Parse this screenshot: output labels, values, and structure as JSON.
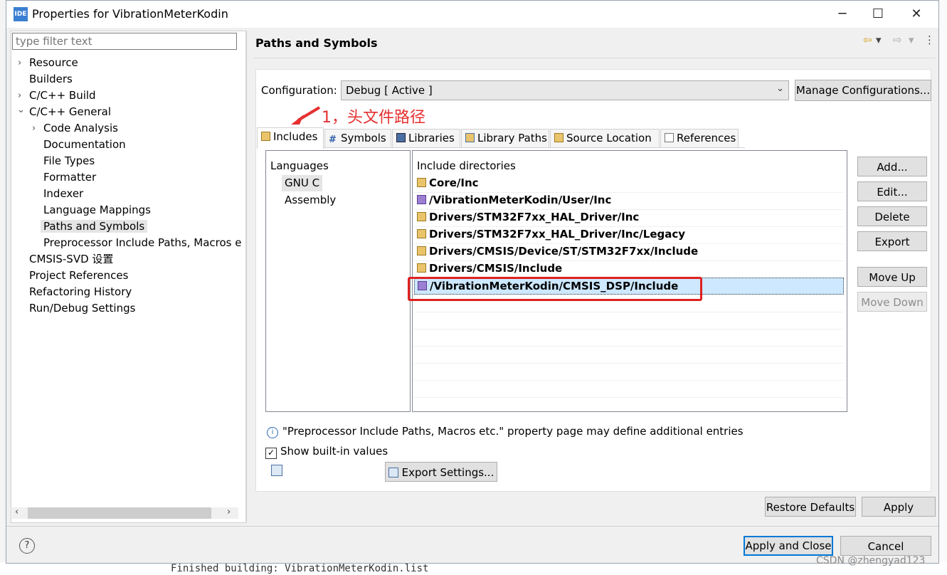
{
  "window": {
    "title": "Properties for VibrationMeterKodin",
    "icon_label": "IDE",
    "controls": [
      "─",
      "☐",
      "✕"
    ]
  },
  "filter": {
    "placeholder": "type filter text"
  },
  "tree": [
    {
      "label": "Resource",
      "twisty": "›"
    },
    {
      "label": "Builders",
      "twisty": ""
    },
    {
      "label": "C/C++ Build",
      "twisty": "›"
    },
    {
      "label": "C/C++ General",
      "twisty": "⌄"
    },
    {
      "label": "Code Analysis",
      "twisty": "›"
    },
    {
      "label": "Documentation",
      "twisty": ""
    },
    {
      "label": "File Types",
      "twisty": ""
    },
    {
      "label": "Formatter",
      "twisty": ""
    },
    {
      "label": "Indexer",
      "twisty": ""
    },
    {
      "label": "Language Mappings",
      "twisty": ""
    },
    {
      "label": "Paths and Symbols",
      "twisty": ""
    },
    {
      "label": "Preprocessor Include Paths, Macros e",
      "twisty": ""
    },
    {
      "label": "CMSIS-SVD 设置",
      "twisty": ""
    },
    {
      "label": "Project References",
      "twisty": ""
    },
    {
      "label": "Refactoring History",
      "twisty": ""
    },
    {
      "label": "Run/Debug Settings",
      "twisty": ""
    }
  ],
  "page": {
    "title": "Paths and Symbols",
    "nav": {
      "back": "⇦",
      "dropdown": "▾",
      "forward": "⇨",
      "more": "⋮"
    }
  },
  "configuration": {
    "label": "Configuration:",
    "value": "Debug  [ Active ]",
    "manage_button": "Manage Configurations..."
  },
  "annotation": {
    "text": "1，头文件路径",
    "color": "#e53030"
  },
  "tabs": [
    "Includes",
    "Symbols",
    "Libraries",
    "Library Paths",
    "Source Location",
    "References"
  ],
  "languages": {
    "header": "Languages",
    "items": [
      "GNU C",
      "Assembly"
    ],
    "selected": "GNU C"
  },
  "includes": {
    "header": "Include directories",
    "items": [
      {
        "path": "Core/Inc",
        "type": "folder"
      },
      {
        "path": "/VibrationMeterKodin/User/Inc",
        "type": "workspace"
      },
      {
        "path": "Drivers/STM32F7xx_HAL_Driver/Inc",
        "type": "folder"
      },
      {
        "path": "Drivers/STM32F7xx_HAL_Driver/Inc/Legacy",
        "type": "folder"
      },
      {
        "path": "Drivers/CMSIS/Device/ST/STM32F7xx/Include",
        "type": "folder"
      },
      {
        "path": "Drivers/CMSIS/Include",
        "type": "folder"
      },
      {
        "path": "/VibrationMeterKodin/CMSIS_DSP/Include",
        "type": "workspace",
        "selected": true
      }
    ]
  },
  "side_buttons": {
    "add": "Add...",
    "edit": "Edit...",
    "delete": "Delete",
    "export": "Export",
    "move_up": "Move Up",
    "move_down": "Move Down"
  },
  "info": "\"Preprocessor Include Paths, Macros etc.\" property page may define additional entries",
  "show_builtin": {
    "label": "Show built-in values",
    "checked": true
  },
  "export_settings": "Export Settings...",
  "footer": {
    "restore_defaults": "Restore Defaults",
    "apply": "Apply",
    "apply_close": "Apply and Close",
    "cancel": "Cancel",
    "help": "?"
  },
  "background": {
    "console_text": "Finished building: VibrationMeterKodin.list"
  },
  "watermark": "CSDN @zhengyad123"
}
